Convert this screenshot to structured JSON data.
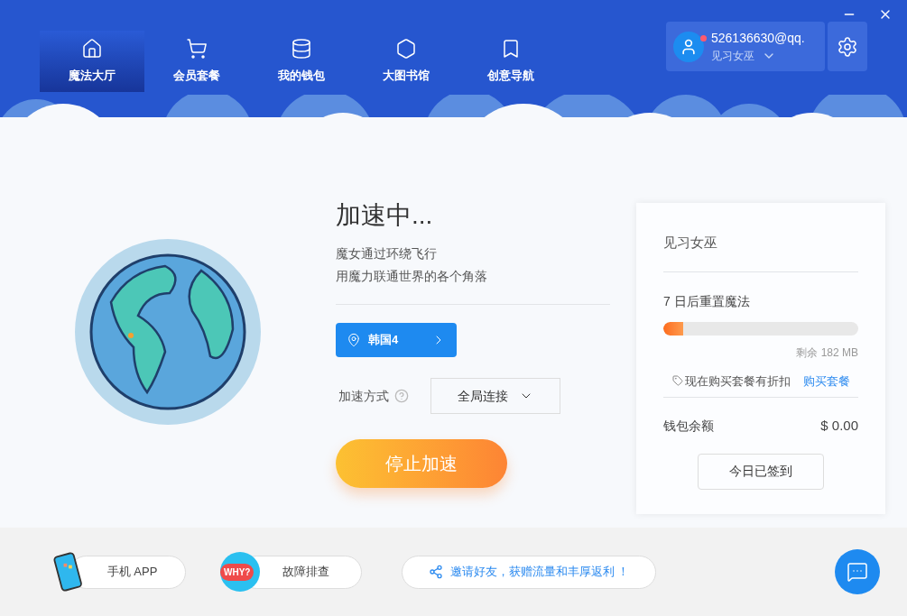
{
  "nav": {
    "tabs": [
      {
        "label": "魔法大厅",
        "selected": true
      },
      {
        "label": "会员套餐",
        "selected": false
      },
      {
        "label": "我的钱包",
        "selected": false
      },
      {
        "label": "大图书馆",
        "selected": false
      },
      {
        "label": "创意导航",
        "selected": false
      }
    ]
  },
  "user": {
    "account": "526136630@qq.",
    "rank": "见习女巫",
    "online": true
  },
  "status": {
    "title": "加速中...",
    "lines": [
      "魔女通过环绕飞行",
      "用魔力联通世界的各个角落"
    ],
    "server": "韩国4",
    "mode_label": "加速方式",
    "mode_value": "全局连接",
    "stop_button": "停止加速"
  },
  "card": {
    "title": "见习女巫",
    "reset": "7 日后重置魔法",
    "level": 0.1,
    "remaining": "剩余 182 MB",
    "promo": "现在购买套餐有折扣",
    "buy_link": "购买套餐",
    "wallet_label": "钱包余额",
    "wallet_value": "$ 0.00",
    "checkin_button": "今日已签到"
  },
  "footer": {
    "app": "手机 APP",
    "why_badge": "WHY?",
    "troubleshoot": "故障排查",
    "invite": "邀请好友，获赠流量和丰厚返利 ！"
  }
}
